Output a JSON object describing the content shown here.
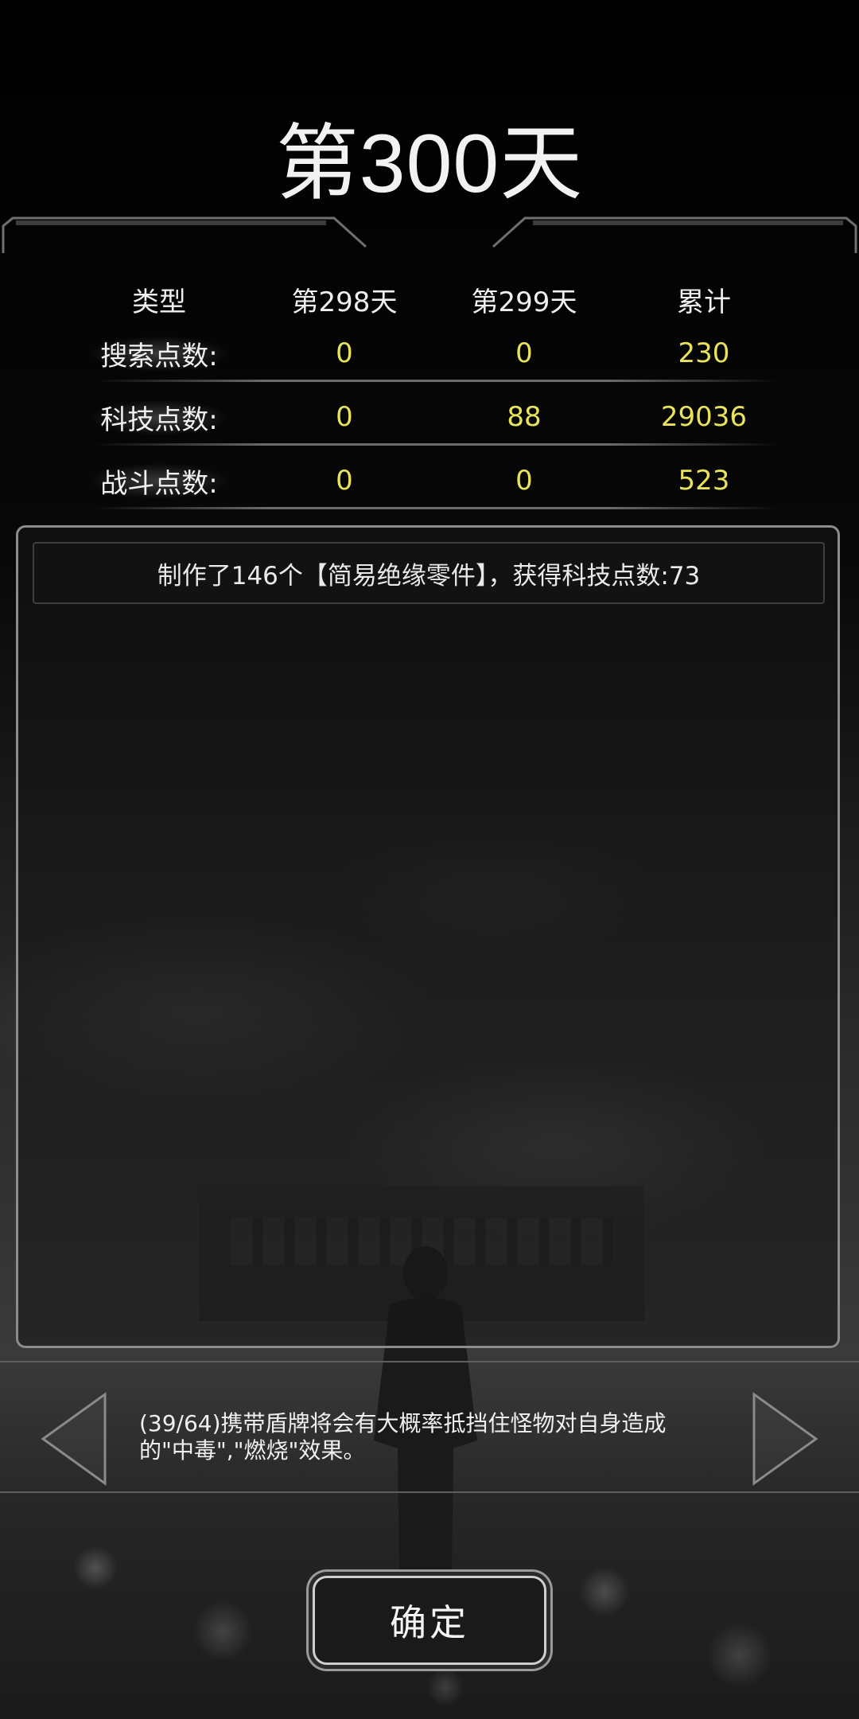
{
  "title": "第300天",
  "stats": {
    "headers": [
      "类型",
      "第298天",
      "第299天",
      "累计"
    ],
    "rows": [
      {
        "label": "搜索点数:",
        "day298": "0",
        "day299": "0",
        "total": "230"
      },
      {
        "label": "科技点数:",
        "day298": "0",
        "day299": "88",
        "total": "29036"
      },
      {
        "label": "战斗点数:",
        "day298": "0",
        "day299": "0",
        "total": "523"
      }
    ]
  },
  "log": {
    "entries": [
      "制作了146个【简易绝缘零件】，获得科技点数:73"
    ]
  },
  "tip": {
    "line1": "(39/64)携带盾牌将会有大概率抵挡住怪物对自身造成",
    "line2": "的\"中毒\",\"燃烧\"效果。"
  },
  "confirm_label": "确定",
  "colors": {
    "value_yellow": "#e8e35a",
    "text_white": "#f0f0f0",
    "panel_border": "#8c8c8c"
  },
  "icons": {
    "prev": "triangle-left-icon",
    "next": "triangle-right-icon"
  }
}
